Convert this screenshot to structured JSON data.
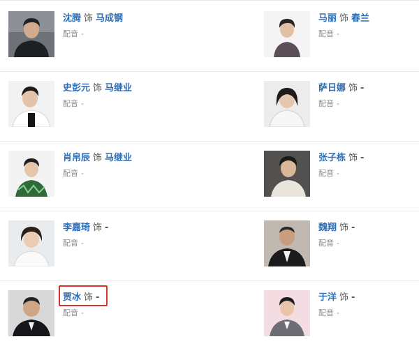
{
  "colors": {
    "link": "#2f6fb6",
    "text": "#555555",
    "muted": "#8a8a8a",
    "highlight": "#d8322b"
  },
  "cast": [
    {
      "actor": "沈腾",
      "as": "饰",
      "role": "马成钢",
      "voice_label": "配音",
      "voice_value": "-",
      "photo_icon": "actor-photo"
    },
    {
      "actor": "马丽",
      "as": "饰",
      "role": "春兰",
      "voice_label": "配音",
      "voice_value": "-",
      "photo_icon": "actor-photo"
    },
    {
      "actor": "史彭元",
      "as": "饰",
      "role": "马继业",
      "voice_label": "配音",
      "voice_value": "-",
      "photo_icon": "actor-photo"
    },
    {
      "actor": "萨日娜",
      "as": "饰",
      "role": "-",
      "voice_label": "配音",
      "voice_value": "-",
      "photo_icon": "actor-photo"
    },
    {
      "actor": "肖帛辰",
      "as": "饰",
      "role": "马继业",
      "voice_label": "配音",
      "voice_value": "-",
      "photo_icon": "actor-photo"
    },
    {
      "actor": "张子栋",
      "as": "饰",
      "role": "-",
      "voice_label": "配音",
      "voice_value": "-",
      "photo_icon": "actor-photo"
    },
    {
      "actor": "李嘉琦",
      "as": "饰",
      "role": "-",
      "voice_label": "配音",
      "voice_value": "-",
      "photo_icon": "actor-photo"
    },
    {
      "actor": "魏翔",
      "as": "饰",
      "role": "-",
      "voice_label": "配音",
      "voice_value": "-",
      "photo_icon": "actor-photo"
    },
    {
      "actor": "贾冰",
      "as": "饰",
      "role": "-",
      "voice_label": "配音",
      "voice_value": "-",
      "photo_icon": "actor-photo"
    },
    {
      "actor": "于洋",
      "as": "饰",
      "role": "-",
      "voice_label": "配音",
      "voice_value": "-",
      "photo_icon": "actor-photo"
    }
  ]
}
